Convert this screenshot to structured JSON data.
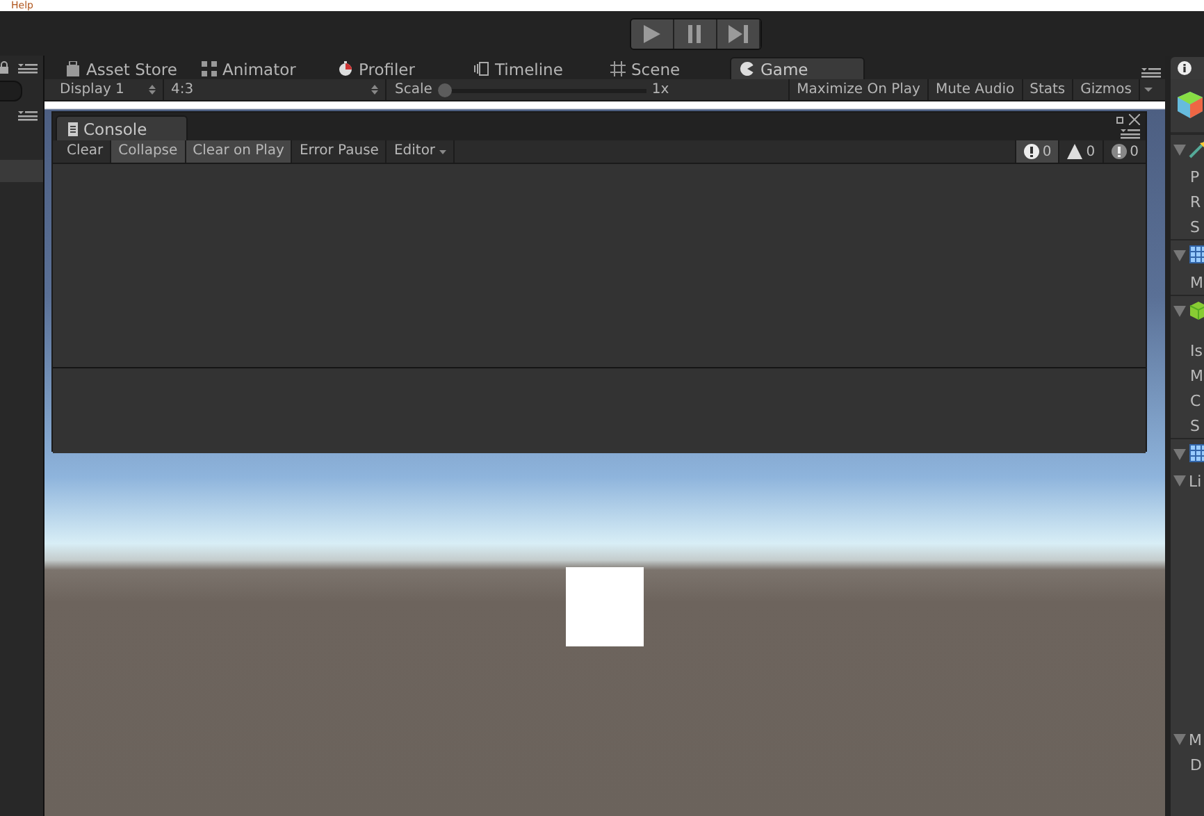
{
  "menu": {
    "items": [
      "Help"
    ]
  },
  "play_controls": [
    {
      "kind": "play",
      "selected": false
    },
    {
      "kind": "pause",
      "selected": false
    },
    {
      "kind": "step",
      "selected": false
    }
  ],
  "view_tabs": [
    {
      "kind": "store",
      "label": "Asset Store",
      "selected": false
    },
    {
      "kind": "animator",
      "label": "Animator",
      "selected": false
    },
    {
      "kind": "profiler",
      "label": "Profiler",
      "selected": false
    },
    {
      "kind": "timeline",
      "label": "Timeline",
      "selected": false
    },
    {
      "kind": "scene",
      "label": "Scene",
      "selected": false
    },
    {
      "kind": "game",
      "label": "Game",
      "selected": true
    }
  ],
  "game_toolbar": {
    "display": "Display 1",
    "aspect": "4:3",
    "scale_label": "Scale",
    "scale": {
      "level": 0.0
    },
    "scale_value": "1x",
    "toggles": [
      {
        "label": "Maximize On Play",
        "selected": false
      },
      {
        "label": "Mute Audio",
        "selected": false
      },
      {
        "label": "Stats",
        "selected": false
      },
      {
        "label": "Gizmos",
        "selected": false
      }
    ]
  },
  "console": {
    "title": "Console",
    "buttons": [
      {
        "kind": "button",
        "label": "Clear",
        "selected": false
      },
      {
        "kind": "button",
        "label": "Collapse",
        "selected": true
      },
      {
        "kind": "button",
        "label": "Clear on Play",
        "selected": true
      },
      {
        "kind": "button",
        "label": "Error Pause",
        "selected": false
      },
      {
        "kind": "dropdown",
        "label": "Editor",
        "selected": false
      }
    ],
    "counts": [
      {
        "kind": "info",
        "count": "0",
        "selected": true
      },
      {
        "kind": "warning",
        "count": "0",
        "selected": false
      },
      {
        "kind": "error",
        "count": "0",
        "selected": false
      }
    ]
  },
  "inspector": {
    "rows": [
      {
        "kind": "transform"
      },
      {
        "kind": "field",
        "label": "P"
      },
      {
        "kind": "field",
        "label": "R"
      },
      {
        "kind": "field",
        "label": "S"
      },
      {
        "kind": "mesh"
      },
      {
        "kind": "field",
        "label": "M"
      },
      {
        "kind": "cube"
      },
      {
        "kind": "space"
      },
      {
        "kind": "field",
        "label": "Is"
      },
      {
        "kind": "field",
        "label": "M"
      },
      {
        "kind": "field",
        "label": "C"
      },
      {
        "kind": "field",
        "label": "S"
      },
      {
        "kind": "mesh"
      },
      {
        "kind": "foldout",
        "label": "Li"
      },
      {
        "kind": "bigspace"
      },
      {
        "kind": "foldout",
        "label": "M"
      },
      {
        "kind": "field",
        "label": "D"
      }
    ]
  }
}
